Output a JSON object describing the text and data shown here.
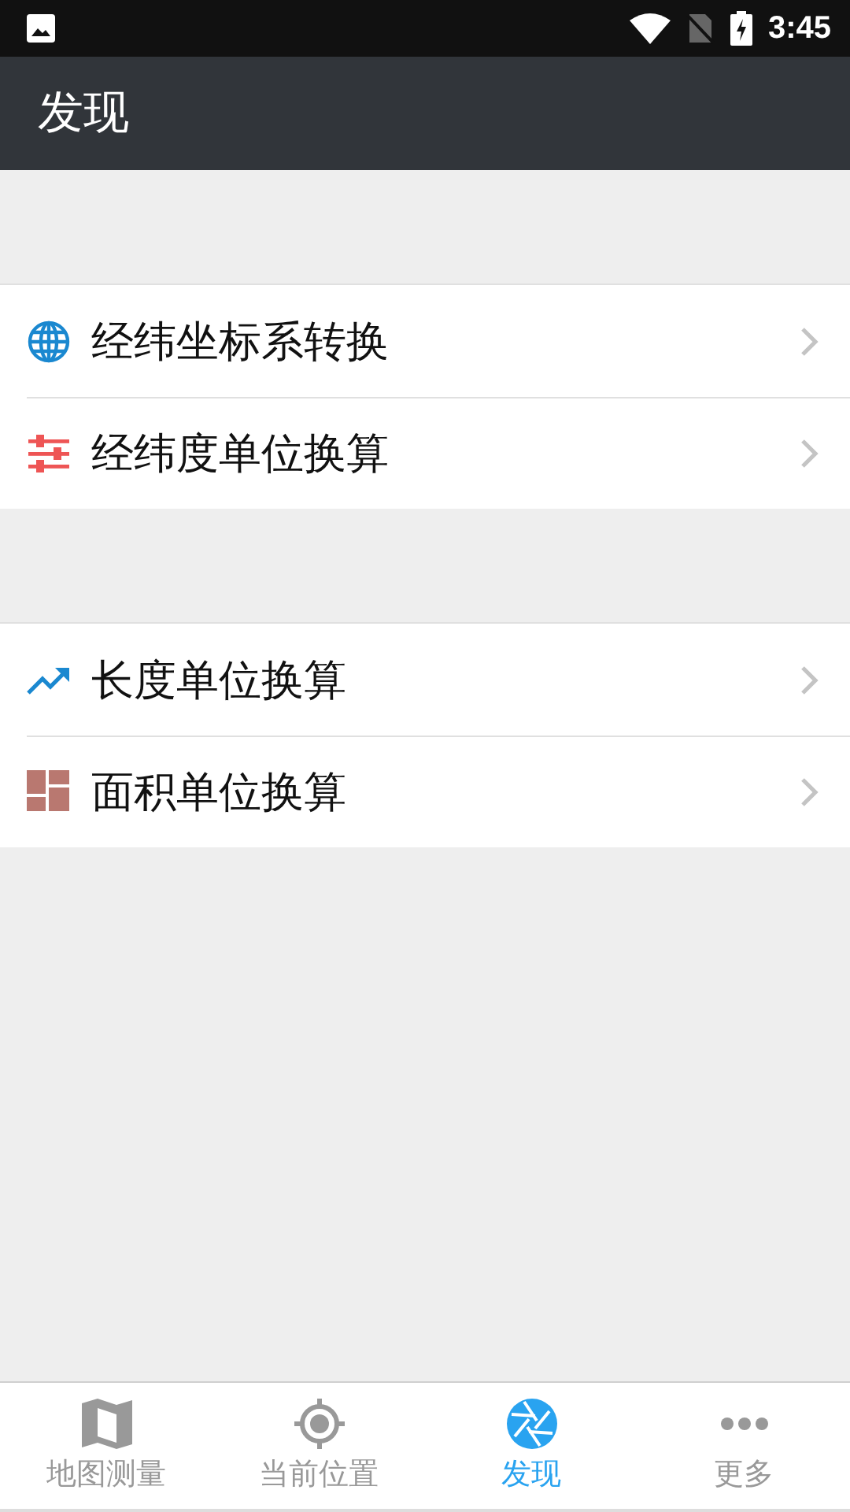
{
  "status_bar": {
    "time": "3:45"
  },
  "app_bar": {
    "title": "发现"
  },
  "groups": [
    {
      "items": [
        {
          "label": "经纬坐标系转换",
          "kind": "globe"
        },
        {
          "label": "经纬度单位换算",
          "kind": "sliders"
        }
      ]
    },
    {
      "items": [
        {
          "label": "长度单位换算",
          "kind": "trend"
        },
        {
          "label": "面积单位换算",
          "kind": "tiles"
        }
      ]
    }
  ],
  "bottom_nav": [
    {
      "label": "地图测量",
      "kind": "map",
      "selected": false
    },
    {
      "label": "当前位置",
      "kind": "target",
      "selected": false
    },
    {
      "label": "发现",
      "kind": "aperture",
      "selected": true
    },
    {
      "label": "更多",
      "kind": "dots",
      "selected": false
    }
  ]
}
